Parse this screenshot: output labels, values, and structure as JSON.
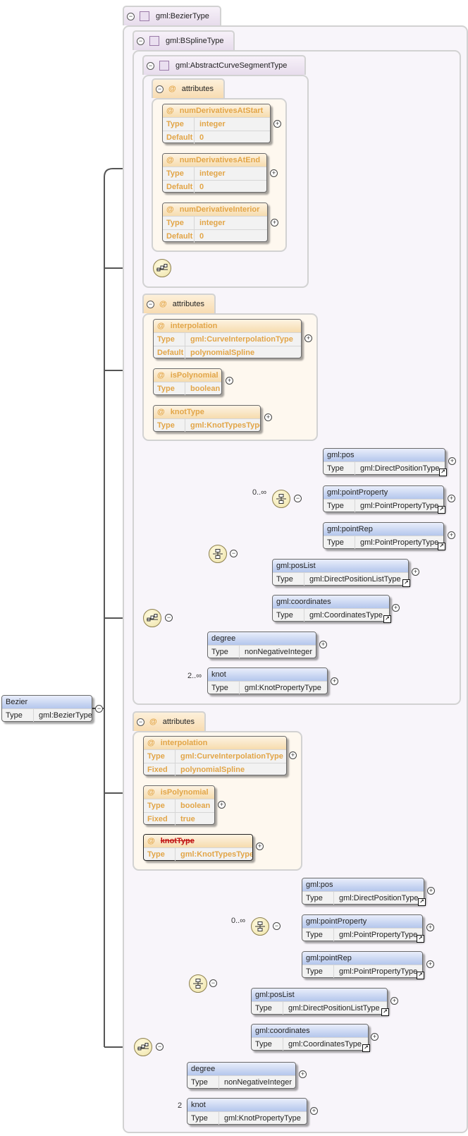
{
  "root": {
    "name": "Bezier",
    "type_label": "Type",
    "type": "gml:BezierType"
  },
  "types": {
    "bezier": "gml:BezierType",
    "bspline": "gml:BSplineType",
    "abstract": "gml:AbstractCurveSegmentType"
  },
  "attributes_label": "attributes",
  "abstract_attrs": [
    {
      "name": "numDerivativesAtStart",
      "rows": [
        [
          "Type",
          "integer"
        ],
        [
          "Default",
          "0"
        ]
      ]
    },
    {
      "name": "numDerivativesAtEnd",
      "rows": [
        [
          "Type",
          "integer"
        ],
        [
          "Default",
          "0"
        ]
      ]
    },
    {
      "name": "numDerivativeInterior",
      "rows": [
        [
          "Type",
          "integer"
        ],
        [
          "Default",
          "0"
        ]
      ]
    }
  ],
  "bspline_attrs": [
    {
      "name": "interpolation",
      "rows": [
        [
          "Type",
          "gml:CurveInterpolationType"
        ],
        [
          "Default",
          "polynomialSpline"
        ]
      ]
    },
    {
      "name": "isPolynomial",
      "rows": [
        [
          "Type",
          "boolean"
        ]
      ]
    },
    {
      "name": "knotType",
      "rows": [
        [
          "Type",
          "gml:KnotTypesType"
        ]
      ]
    }
  ],
  "bezier_attrs": [
    {
      "name": "interpolation",
      "rows": [
        [
          "Type",
          "gml:CurveInterpolationType"
        ],
        [
          "Fixed",
          "polynomialSpline"
        ]
      ]
    },
    {
      "name": "isPolynomial",
      "rows": [
        [
          "Type",
          "boolean"
        ],
        [
          "Fixed",
          "true"
        ]
      ]
    },
    {
      "name": "knotType",
      "rows": [
        [
          "Type",
          "gml:KnotTypesType"
        ]
      ],
      "prohibited": true
    }
  ],
  "bspline_seq": {
    "choice_cardinality": "0..∞",
    "choice": [
      {
        "name": "gml:pos",
        "type": "gml:DirectPositionType"
      },
      {
        "name": "gml:pointProperty",
        "type": "gml:PointPropertyType"
      },
      {
        "name": "gml:pointRep",
        "type": "gml:PointPropertyType"
      }
    ],
    "posList": {
      "name": "gml:posList",
      "type": "gml:DirectPositionListType"
    },
    "coordinates": {
      "name": "gml:coordinates",
      "type": "gml:CoordinatesType"
    },
    "degree": {
      "name": "degree",
      "type": "nonNegativeInteger"
    },
    "knot": {
      "name": "knot",
      "type": "gml:KnotPropertyType",
      "cardinality": "2..∞"
    }
  },
  "bezier_seq": {
    "choice_cardinality": "0..∞",
    "choice": [
      {
        "name": "gml:pos",
        "type": "gml:DirectPositionType"
      },
      {
        "name": "gml:pointProperty",
        "type": "gml:PointPropertyType"
      },
      {
        "name": "gml:pointRep",
        "type": "gml:PointPropertyType"
      }
    ],
    "posList": {
      "name": "gml:posList",
      "type": "gml:DirectPositionListType"
    },
    "coordinates": {
      "name": "gml:coordinates",
      "type": "gml:CoordinatesType"
    },
    "degree": {
      "name": "degree",
      "type": "nonNegativeInteger"
    },
    "knot": {
      "name": "knot",
      "type": "gml:KnotPropertyType",
      "cardinality": "2"
    }
  }
}
